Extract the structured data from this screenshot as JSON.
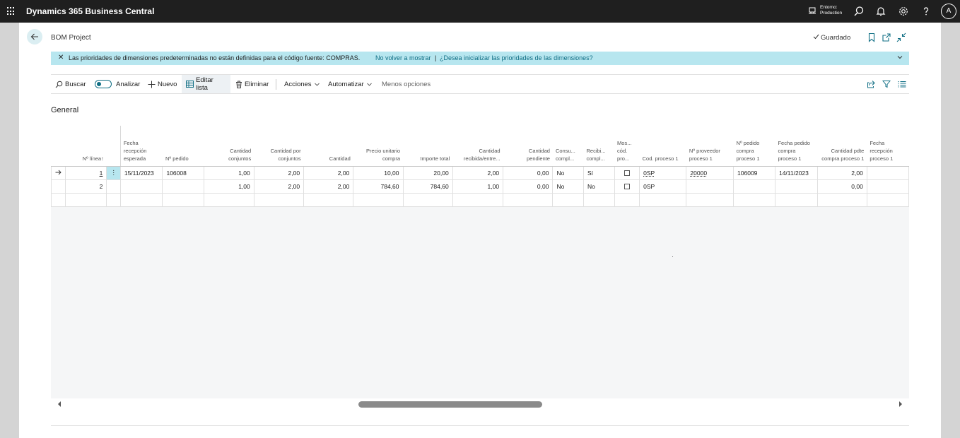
{
  "app": {
    "title": "Dynamics 365 Business Central",
    "environment_label": "Entorno:",
    "environment_value": "Production",
    "user_initial": "A"
  },
  "header": {
    "page_title": "BOM Project",
    "saved_label": "Guardado"
  },
  "notification": {
    "message": "Las prioridades de dimensiones predeterminadas no están definidas para el código fuente: COMPRAS.",
    "link_dismiss": "No volver a mostrar",
    "separator": "|",
    "link_init": "¿Desea inicializar las prioridades de las dimensiones?"
  },
  "actions": {
    "search": "Buscar",
    "analyze": "Analizar",
    "new": "Nuevo",
    "edit_list": "Editar lista",
    "delete": "Eliminar",
    "actions": "Acciones",
    "automate": "Automatizar",
    "fewer_options": "Menos opciones"
  },
  "section": {
    "title": "General"
  },
  "table": {
    "columns": {
      "line_no": "Nº línea",
      "expected_receipt": "Fecha recepción esperada",
      "order_no": "Nº pedido",
      "qty_assemblies": "Cantidad conjuntos",
      "qty_per_assembly": "Cantidad por conjuntos",
      "quantity": "Cantidad",
      "unit_price": "Precio unitario compra",
      "total_amount": "Importe total",
      "qty_received": "Cantidad recibida/entre...",
      "qty_pending": "Cantidad pendiente",
      "consumed": "Consu... compl...",
      "received": "Recibi... compl...",
      "show_code": "Mos... cód. pro...",
      "process_code": "Cod. proceso 1",
      "vendor_no": "Nº proveedor proceso 1",
      "purchase_order_no": "Nº pedido compra proceso 1",
      "purchase_order_date": "Fecha pedido compra proceso 1",
      "qty_pending_purchase": "Cantidad pdte compra proceso 1",
      "receipt_date": "Fecha recepción proceso 1"
    },
    "rows": [
      {
        "line_no": "1",
        "expected_receipt": "15/11/2023",
        "order_no": "106008",
        "qty_assemblies": "1,00",
        "qty_per_assembly": "2,00",
        "quantity": "2,00",
        "unit_price": "10,00",
        "total_amount": "20,00",
        "qty_received": "2,00",
        "qty_pending": "0,00",
        "consumed": "No",
        "received": "Sí",
        "show_code": false,
        "process_code": "0SP",
        "vendor_no": "20000",
        "purchase_order_no": "106009",
        "purchase_order_date": "14/11/2023",
        "qty_pending_purchase": "2,00",
        "receipt_date": ""
      },
      {
        "line_no": "2",
        "expected_receipt": "",
        "order_no": "",
        "qty_assemblies": "1,00",
        "qty_per_assembly": "2,00",
        "quantity": "2,00",
        "unit_price": "784,60",
        "total_amount": "784,60",
        "qty_received": "1,00",
        "qty_pending": "0,00",
        "consumed": "No",
        "received": "No",
        "show_code": false,
        "process_code": "0SP",
        "vendor_no": "",
        "purchase_order_no": "",
        "purchase_order_date": "",
        "qty_pending_purchase": "0,00",
        "receipt_date": ""
      }
    ]
  },
  "icons": {
    "waffle": "app-launcher-icon",
    "environment": "environment-icon",
    "search": "search-icon",
    "bell": "notifications-icon",
    "settings": "gear-icon",
    "help": "help-icon",
    "back": "back-arrow-icon",
    "bookmark": "bookmark-icon",
    "open_new": "open-in-new-window-icon",
    "collapse": "collapse-icon",
    "share": "share-icon",
    "filter": "filter-icon",
    "list": "list-view-icon"
  },
  "colors": {
    "topbar": "#1f1f1f",
    "notification_bg": "#b7e6ef",
    "accent": "#0f6e84",
    "selected_row_menu": "#b7e6ef"
  }
}
